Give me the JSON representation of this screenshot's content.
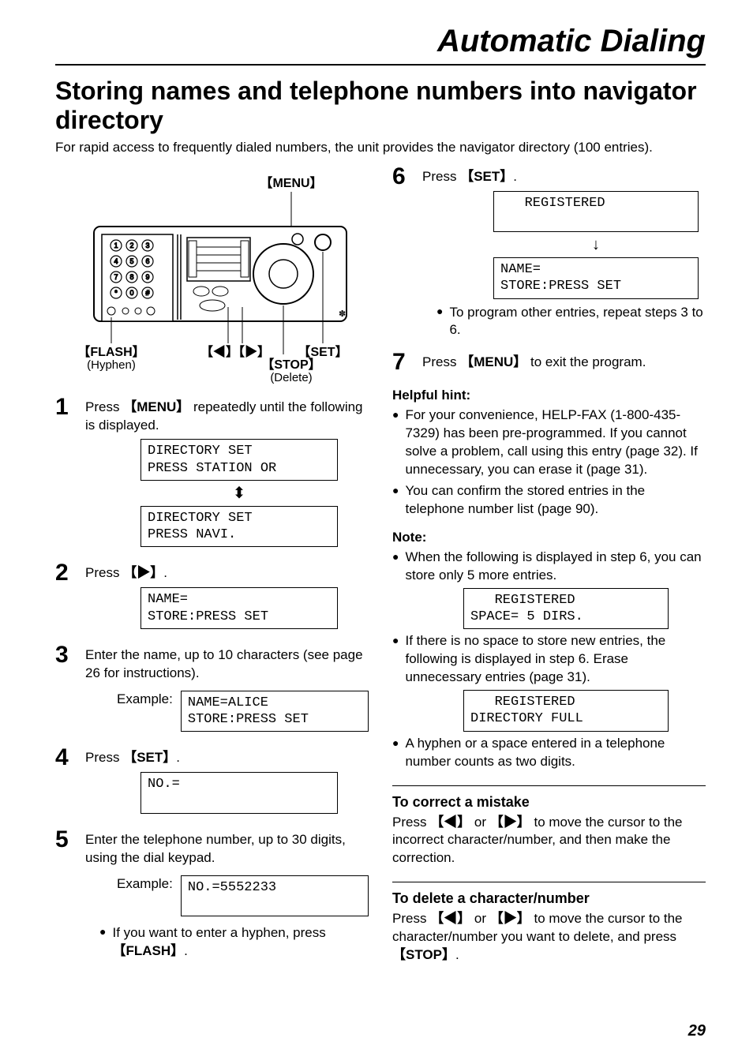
{
  "header": {
    "pageTitle": "Automatic Dialing"
  },
  "section": {
    "title": "Storing names and telephone numbers into navigator directory",
    "intro": "For rapid access to frequently dialed numbers, the unit provides the navigator directory (100 entries)."
  },
  "diagram": {
    "labels": {
      "menu": "MENU",
      "flash": "FLASH",
      "flashSub": "(Hyphen)",
      "arrows": "◀ 】【 ▶",
      "set": "SET",
      "stop": "STOP",
      "stopSub": "(Delete)"
    }
  },
  "steps": [
    {
      "num": "1",
      "text_a": "Press ",
      "key": "MENU",
      "text_b": " repeatedly until the following is displayed.",
      "lcd_stack": [
        "DIRECTORY SET\nPRESS STATION OR",
        "DIRECTORY SET\nPRESS NAVI."
      ],
      "arrow": "⬍"
    },
    {
      "num": "2",
      "text_a": "Press ",
      "key": "▶",
      "text_b": ".",
      "lcd_stack": [
        "NAME=\nSTORE:PRESS SET"
      ]
    },
    {
      "num": "3",
      "text_a": "Enter the name, up to 10 characters (see page 26 for instructions).",
      "exampleLabel": "Example:",
      "lcd_stack": [
        "NAME=ALICE\nSTORE:PRESS SET"
      ]
    },
    {
      "num": "4",
      "text_a": "Press ",
      "key": "SET",
      "text_b": ".",
      "lcd_stack": [
        "NO.=\n "
      ]
    },
    {
      "num": "5",
      "text_a": "Enter the telephone number, up to 30 digits, using the dial keypad.",
      "exampleLabel": "Example:",
      "lcd_stack": [
        "NO.=5552233\n "
      ],
      "bullet_a": "If you want to enter a hyphen, press ",
      "bullet_key": "FLASH",
      "bullet_b": "."
    },
    {
      "num": "6",
      "text_a": "Press ",
      "key": "SET",
      "text_b": ".",
      "lcd_stack": [
        "   REGISTERED\n ",
        "NAME=\nSTORE:PRESS SET"
      ],
      "arrow": "↓",
      "bullet_a": "To program other entries, repeat steps 3 to 6."
    },
    {
      "num": "7",
      "text_a": "Press ",
      "key": "MENU",
      "text_b": " to exit the program."
    }
  ],
  "hints": {
    "head": "Helpful hint:",
    "items": [
      "For your convenience, HELP-FAX (1-800-435-7329) has been pre-programmed. If you cannot solve a problem, call using this entry (page 32). If unnecessary, you can erase it (page 31).",
      "You can confirm the stored entries in the telephone number list (page 90)."
    ]
  },
  "note": {
    "head": "Note:",
    "items": [
      {
        "text": "When the following is displayed in step 6, you can store only 5 more entries.",
        "lcd": "   REGISTERED\nSPACE= 5 DIRS."
      },
      {
        "text": "If there is no space to store new entries, the following is displayed in step 6. Erase unnecessary entries (page 31).",
        "lcd": "   REGISTERED\nDIRECTORY FULL"
      },
      {
        "text": "A hyphen or a space entered in a telephone number counts as two digits."
      }
    ]
  },
  "correct": {
    "head": "To correct a mistake",
    "body_a": "Press ",
    "k1": "◀",
    "mid": " or ",
    "k2": "▶",
    "body_b": " to move the cursor to the incorrect character/number, and then make the correction."
  },
  "delete": {
    "head": "To delete a character/number",
    "body_a": "Press ",
    "k1": "◀",
    "mid": " or ",
    "k2": "▶",
    "body_b": " to move the cursor to the character/number you want to delete, and press ",
    "k3": "STOP",
    "body_c": "."
  },
  "pageNumber": "29",
  "glyphs": {
    "lb": "【",
    "rb": "】",
    "tri_l": "◀",
    "tri_r": "▶"
  }
}
